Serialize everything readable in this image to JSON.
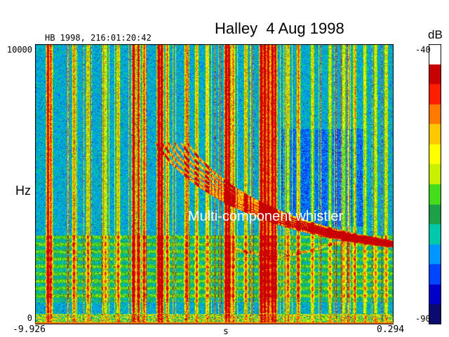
{
  "header": {
    "title": "Halley  4 Aug 1998",
    "station_line": "HB 1998, 216:01:20:42"
  },
  "annotation": {
    "text": "Multi-component whistler"
  },
  "colors": {
    "scale": [
      "#0a0a70",
      "#0000c8",
      "#0046ff",
      "#0096ff",
      "#00c8aa",
      "#1ea046",
      "#46dc1e",
      "#c8f000",
      "#ffff00",
      "#ffc800",
      "#ff7800",
      "#ff1e00",
      "#c80000",
      "#ffffff"
    ]
  },
  "chart_data": {
    "type": "heatmap",
    "title": "Halley  4 Aug 1998",
    "xlabel": "s",
    "ylabel": "Hz",
    "xlim": [
      -9.926,
      0.294
    ],
    "ylim": [
      0,
      10000
    ],
    "x_tick_labels": [
      "-9.926",
      "0.294"
    ],
    "y_tick_labels": [
      "10000",
      "0"
    ],
    "colorbar": {
      "label": "dB",
      "range": [
        -90,
        -40
      ],
      "tick_labels": [
        "-40",
        "-90"
      ]
    },
    "features": [
      {
        "name": "Multi-component whistler",
        "annotation_text": "Multi-component whistler"
      }
    ]
  }
}
